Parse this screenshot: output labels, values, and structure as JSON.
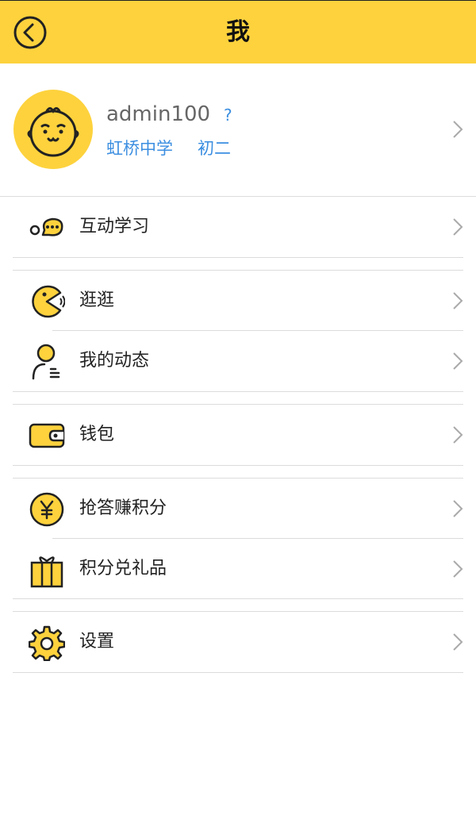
{
  "header": {
    "title": "我",
    "back_icon": "back-arrow-icon"
  },
  "profile": {
    "username": "admin100",
    "help_mark": "?",
    "school": "虹桥中学",
    "grade": "初二",
    "avatar_icon": "baby-face-icon"
  },
  "menu": {
    "interactive_learning": "互动学习",
    "browse": "逛逛",
    "my_activity": "我的动态",
    "wallet": "钱包",
    "quiz_points": "抢答赚积分",
    "points_gifts": "积分兑礼品",
    "settings": "设置"
  },
  "colors": {
    "accent": "#fdd23d",
    "link": "#3b8ee0",
    "icon_stroke": "#222222"
  }
}
